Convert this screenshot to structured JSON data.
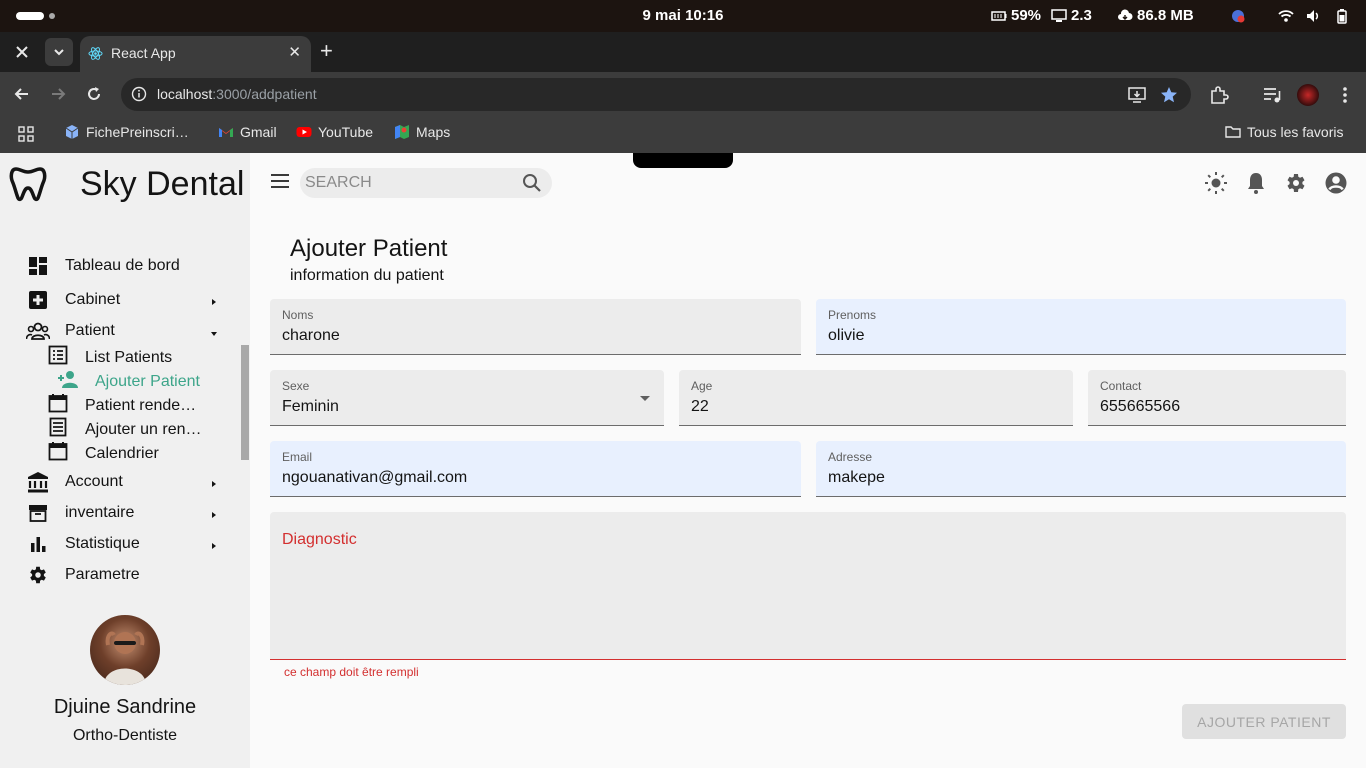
{
  "os": {
    "date_time": "9 mai  10:16",
    "battery_saver": "59%",
    "cpu": "2.3",
    "net": "86.8 MB"
  },
  "browser": {
    "tab_title": "React App",
    "url_host": "localhost",
    "url_path": ":3000/addpatient",
    "bookmarks": [
      "FichePreinscri…",
      "Gmail",
      "YouTube",
      "Maps"
    ],
    "all_bookmarks": "Tous les favoris"
  },
  "app": {
    "brand": "Sky Dental",
    "search_placeholder": "SEARCH",
    "menu": {
      "dashboard": "Tableau de bord",
      "cabinet": "Cabinet",
      "patient": "Patient",
      "patient_sub": {
        "list": "List Patients",
        "add": "Ajouter Patient",
        "rdv": "Patient rende…",
        "add_rdv": "Ajouter un ren…",
        "calendar": "Calendrier"
      },
      "account": "Account",
      "inventory": "inventaire",
      "stats": "Statistique",
      "settings": "Parametre"
    },
    "user": {
      "name": "Djuine Sandrine",
      "role": "Ortho-Dentiste"
    },
    "colors": {
      "accent": "#3da58a",
      "error": "#d32f2f"
    }
  },
  "form": {
    "title": "Ajouter Patient",
    "subtitle": "information du patient",
    "fields": {
      "noms": {
        "label": "Noms",
        "value": "charone"
      },
      "prenoms": {
        "label": "Prenoms",
        "value": "olivie"
      },
      "sexe": {
        "label": "Sexe",
        "value": "Feminin"
      },
      "age": {
        "label": "Age",
        "value": "22"
      },
      "contact": {
        "label": "Contact",
        "value": "655665566"
      },
      "email": {
        "label": "Email",
        "value": "ngouanativan@gmail.com"
      },
      "adresse": {
        "label": "Adresse",
        "value": "makepe"
      },
      "diagnostic": {
        "label": "Diagnostic",
        "value": "",
        "helper": "ce champ doit être rempli"
      }
    },
    "submit_label": "AJOUTER PATIENT"
  }
}
